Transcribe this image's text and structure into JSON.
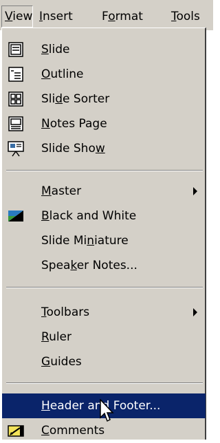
{
  "menubar": {
    "view": [
      "",
      "V",
      "iew"
    ],
    "insert": [
      "",
      "I",
      "nsert"
    ],
    "format": [
      "F",
      "o",
      "rmat"
    ],
    "tools": [
      "",
      "T",
      "ools"
    ]
  },
  "items": [
    {
      "pre": "",
      "u": "S",
      "post": "lide",
      "icon": "slide-icon"
    },
    {
      "pre": "",
      "u": "O",
      "post": "utline",
      "icon": "outline-icon"
    },
    {
      "pre": "Sli",
      "u": "d",
      "post": "e Sorter",
      "icon": "slide-sorter-icon"
    },
    {
      "pre": "",
      "u": "N",
      "post": "otes Page",
      "icon": "notes-page-icon"
    },
    {
      "pre": "Slide Sho",
      "u": "w",
      "post": "",
      "icon": "slide-show-icon"
    },
    {
      "pre": "",
      "u": "M",
      "post": "aster",
      "submenu": true
    },
    {
      "pre": "",
      "u": "B",
      "post": "lack and White",
      "icon": "black-and-white-icon"
    },
    {
      "pre": "Slide Mi",
      "u": "n",
      "post": "iature"
    },
    {
      "pre": "Spea",
      "u": "k",
      "post": "er Notes..."
    },
    {
      "pre": "",
      "u": "T",
      "post": "oolbars",
      "submenu": true
    },
    {
      "pre": "",
      "u": "R",
      "post": "uler"
    },
    {
      "pre": "",
      "u": "G",
      "post": "uides"
    },
    {
      "pre": "",
      "u": "H",
      "post": "eader and Footer...",
      "highlighted": true
    },
    {
      "pre": "",
      "u": "C",
      "post": "omments",
      "icon": "comments-icon"
    }
  ],
  "colors": {
    "menu_bg": "#d4d0c8",
    "highlight_bg": "#0a246a",
    "highlight_text": "#ffffff"
  }
}
